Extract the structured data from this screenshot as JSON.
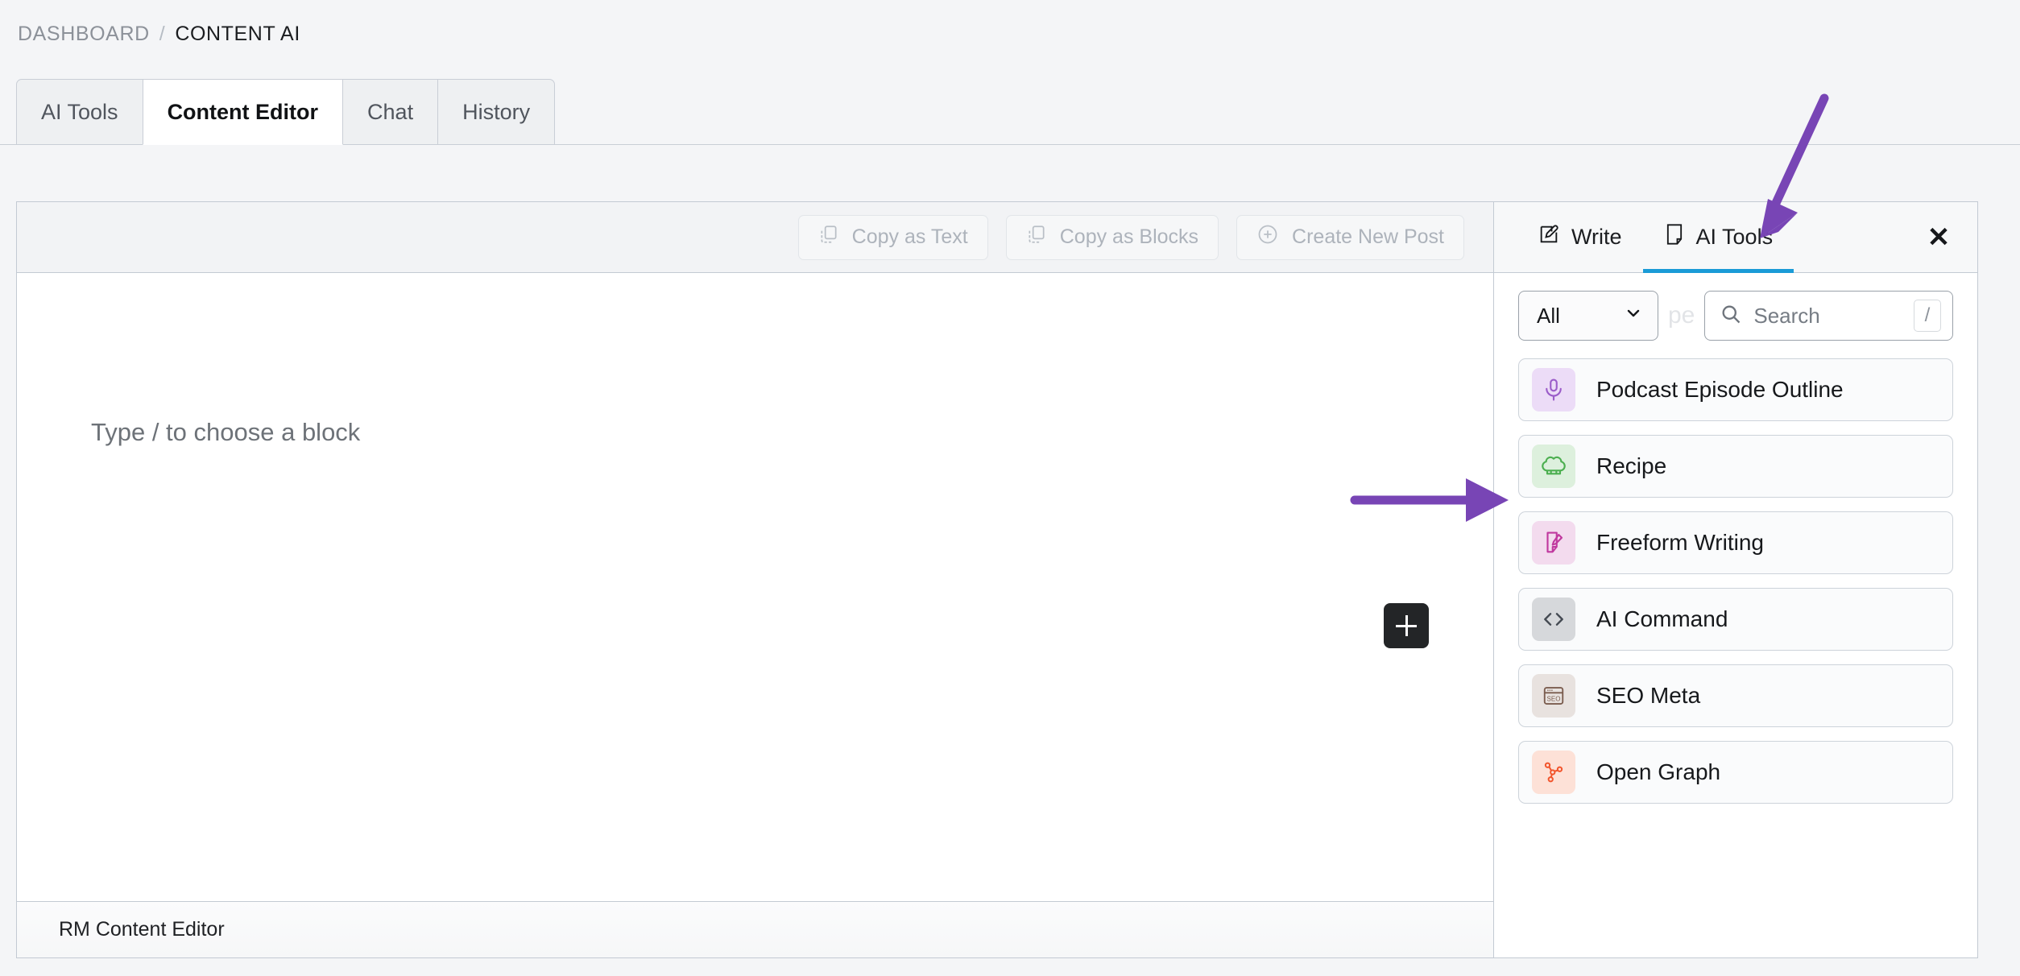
{
  "breadcrumb": {
    "root": "DASHBOARD",
    "separator": "/",
    "current": "CONTENT AI"
  },
  "tabs": [
    {
      "label": "AI Tools",
      "active": false
    },
    {
      "label": "Content Editor",
      "active": true
    },
    {
      "label": "Chat",
      "active": false
    },
    {
      "label": "History",
      "active": false
    }
  ],
  "editor": {
    "toolbar": [
      {
        "label": "Copy as Text",
        "icon": "copy-icon"
      },
      {
        "label": "Copy as Blocks",
        "icon": "copy-icon"
      },
      {
        "label": "Create New Post",
        "icon": "plus-circle-icon"
      }
    ],
    "placeholder": "Type / to choose a block",
    "add_block_icon": "plus-icon",
    "footer_label": "RM Content Editor"
  },
  "panel": {
    "tabs": [
      {
        "label": "Write",
        "icon": "pencil-square-icon",
        "active": false
      },
      {
        "label": "AI Tools",
        "icon": "document-fold-icon",
        "active": true
      }
    ],
    "close_icon": "close-icon",
    "accent": "#1a9bd7",
    "filter": {
      "value": "All",
      "chevron": "chevron-down-icon"
    },
    "ghost_text": "pe",
    "search": {
      "placeholder": "Search",
      "icon": "search-icon",
      "shortcut": "/"
    },
    "tools": [
      {
        "label": "Podcast Episode Outline",
        "icon": "microphone-icon",
        "fg": "#9b5cc9",
        "bg": "#ecdcf7"
      },
      {
        "label": "Recipe",
        "icon": "chef-hat-icon",
        "fg": "#4caf50",
        "bg": "#ddf0dd"
      },
      {
        "label": "Freeform Writing",
        "icon": "document-pencil-icon",
        "fg": "#c0389e",
        "bg": "#f3dbee"
      },
      {
        "label": "AI Command",
        "icon": "code-icon",
        "fg": "#444a52",
        "bg": "#d6d8db"
      },
      {
        "label": "SEO Meta",
        "icon": "seo-window-icon",
        "fg": "#7a5c4e",
        "bg": "#e8e2df"
      },
      {
        "label": "Open Graph",
        "icon": "node-graph-icon",
        "fg": "#f2552c",
        "bg": "#fde1d7"
      }
    ]
  },
  "annotations": {
    "color": "#7845b5",
    "arrow_to_ai_tools_tab": "arrow-down-left",
    "arrow_to_recipe": "arrow-right"
  }
}
